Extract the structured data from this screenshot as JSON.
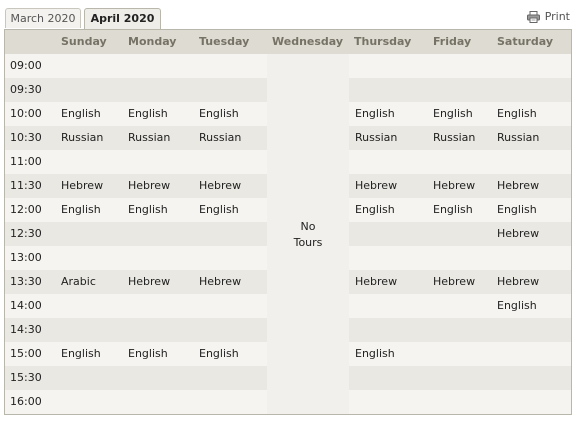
{
  "tabs": [
    {
      "label": "March 2020",
      "active": false
    },
    {
      "label": "April 2020",
      "active": true
    }
  ],
  "print_label": "Print",
  "days": [
    "Sunday",
    "Monday",
    "Tuesday",
    "Wednesday",
    "Thursday",
    "Friday",
    "Saturday"
  ],
  "closed_day": {
    "day": "Wednesday",
    "line1": "No",
    "line2": "Tours"
  },
  "schedule": [
    {
      "time": "09:00",
      "sun": "",
      "mon": "",
      "tue": "",
      "thu": "",
      "fri": "",
      "sat": ""
    },
    {
      "time": "09:30",
      "sun": "",
      "mon": "",
      "tue": "",
      "thu": "",
      "fri": "",
      "sat": ""
    },
    {
      "time": "10:00",
      "sun": "English",
      "mon": "English",
      "tue": "English",
      "thu": "English",
      "fri": "English",
      "sat": "English"
    },
    {
      "time": "10:30",
      "sun": "Russian",
      "mon": "Russian",
      "tue": "Russian",
      "thu": "Russian",
      "fri": "Russian",
      "sat": "Russian"
    },
    {
      "time": "11:00",
      "sun": "",
      "mon": "",
      "tue": "",
      "thu": "",
      "fri": "",
      "sat": ""
    },
    {
      "time": "11:30",
      "sun": "Hebrew",
      "mon": "Hebrew",
      "tue": "Hebrew",
      "thu": "Hebrew",
      "fri": "Hebrew",
      "sat": "Hebrew"
    },
    {
      "time": "12:00",
      "sun": "English",
      "mon": "English",
      "tue": "English",
      "thu": "English",
      "fri": "English",
      "sat": "English"
    },
    {
      "time": "12:30",
      "sun": "",
      "mon": "",
      "tue": "",
      "thu": "",
      "fri": "",
      "sat": "Hebrew"
    },
    {
      "time": "13:00",
      "sun": "",
      "mon": "",
      "tue": "",
      "thu": "",
      "fri": "",
      "sat": ""
    },
    {
      "time": "13:30",
      "sun": "Arabic",
      "mon": "Hebrew",
      "tue": "Hebrew",
      "thu": "Hebrew",
      "fri": "Hebrew",
      "sat": "Hebrew"
    },
    {
      "time": "14:00",
      "sun": "",
      "mon": "",
      "tue": "",
      "thu": "",
      "fri": "",
      "sat": "English"
    },
    {
      "time": "14:30",
      "sun": "",
      "mon": "",
      "tue": "",
      "thu": "",
      "fri": "",
      "sat": ""
    },
    {
      "time": "15:00",
      "sun": "English",
      "mon": "English",
      "tue": "English",
      "thu": "English",
      "fri": "",
      "sat": ""
    },
    {
      "time": "15:30",
      "sun": "",
      "mon": "",
      "tue": "",
      "thu": "",
      "fri": "",
      "sat": ""
    },
    {
      "time": "16:00",
      "sun": "",
      "mon": "",
      "tue": "",
      "thu": "",
      "fri": "",
      "sat": ""
    }
  ],
  "icons": {
    "print": "printer-icon"
  },
  "colors": {
    "header_bg": "#dddbd2",
    "header_text": "#777266",
    "row_light": "#f5f4f0",
    "row_dark": "#e9e8e2",
    "border": "#b9b7ac"
  }
}
